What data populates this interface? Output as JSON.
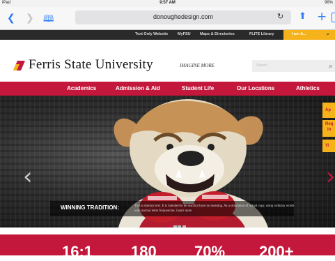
{
  "status_bar": {
    "carrier": "iPad",
    "time": "9:57 AM",
    "battery": "96%"
  },
  "browser": {
    "url": "donoughedesign.com",
    "icons": {
      "back": "back-chevron-icon",
      "forward": "forward-chevron-icon",
      "bookmarks": "book-icon",
      "reload": "reload-icon",
      "share": "share-icon",
      "new_tab": "plus-icon",
      "tabs": "tabs-icon"
    }
  },
  "utility_nav": {
    "links": [
      "Text Only Website",
      "MyFSU",
      "Maps & Directories",
      "FLITE Library"
    ],
    "i_am_label": "I am A..."
  },
  "header": {
    "logo_text": "Ferris State University",
    "tagline": "IMAGINE MORE",
    "search_placeholder": "Search"
  },
  "main_nav": [
    "Academics",
    "Admission & Aid",
    "Student Life",
    "Our Locations",
    "Athletics"
  ],
  "hero": {
    "caption_title": "WINNING TRADITION:",
    "caption_body": "This is dummy text. It is intended to be read but have no meaning. As a simulation of actual copy, using ordinary words with normal letter frequencies. Learn more",
    "dots": 4,
    "active_dot": 0,
    "side_buttons": [
      [
        "Ap"
      ],
      [
        "Req",
        "In"
      ],
      [
        "Vi"
      ]
    ]
  },
  "stats": [
    "16:1",
    "180",
    "70%",
    "200+"
  ],
  "colors": {
    "brand_red": "#c4173c",
    "gold": "#f5b21a",
    "ios_blue": "#2f7cf6"
  }
}
